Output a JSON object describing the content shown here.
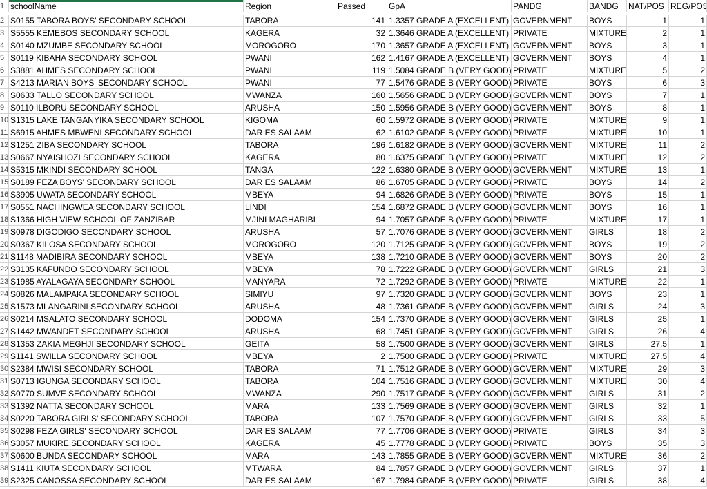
{
  "headers": [
    "schoolName",
    "Region",
    "Passed",
    "GpA",
    "PANDG",
    "BANDG",
    "NAT/POS",
    "REG/POS"
  ],
  "rows": [
    [
      "S0155 TABORA BOYS' SECONDARY SCHOOL",
      "TABORA",
      "141",
      "1.3357  GRADE A (EXCELLENT)",
      "GOVERNMENT",
      "BOYS",
      "1",
      "1"
    ],
    [
      "S5555 KEMEBOS SECONDARY SCHOOL",
      "KAGERA",
      "32",
      "1.3646  GRADE A (EXCELLENT)",
      "PRIVATE",
      "MIXTURE",
      "2",
      "1"
    ],
    [
      "S0140 MZUMBE SECONDARY SCHOOL",
      "MOROGORO",
      "170",
      "1.3657  GRADE A (EXCELLENT)",
      "GOVERNMENT",
      "BOYS",
      "3",
      "1"
    ],
    [
      "S0119 KIBAHA SECONDARY SCHOOL",
      "PWANI",
      "162",
      "1.4167  GRADE A (EXCELLENT)",
      "GOVERNMENT",
      "BOYS",
      "4",
      "1"
    ],
    [
      "S3881 AHMES SECONDARY SCHOOL",
      "PWANI",
      "119",
      "1.5084  GRADE B (VERY GOOD)",
      "PRIVATE",
      "MIXTURE",
      "5",
      "2"
    ],
    [
      "S4213 MARIAN BOYS'  SECONDARY SCHOOL",
      "PWANI",
      "77",
      "1.5476  GRADE B (VERY GOOD)",
      "PRIVATE",
      "BOYS",
      "6",
      "3"
    ],
    [
      "S0633 TALLO SECONDARY SCHOOL",
      "MWANZA",
      "160",
      "1.5656  GRADE B (VERY GOOD)",
      "GOVERNMENT",
      "BOYS",
      "7",
      "1"
    ],
    [
      "S0110 ILBORU SECONDARY SCHOOL",
      "ARUSHA",
      "150",
      "1.5956  GRADE B (VERY GOOD)",
      "GOVERNMENT",
      "BOYS",
      "8",
      "1"
    ],
    [
      "S1315 LAKE TANGANYIKA SECONDARY SCHOOL",
      "KIGOMA",
      "60",
      "1.5972  GRADE B (VERY GOOD)",
      "PRIVATE",
      "MIXTURE",
      "9",
      "1"
    ],
    [
      "S6915 AHMES MBWENI SECONDARY SCHOOL",
      "DAR ES SALAAM",
      "62",
      "1.6102  GRADE B (VERY GOOD)",
      "PRIVATE",
      "MIXTURE",
      "10",
      "1"
    ],
    [
      "S1251 ZIBA SECONDARY SCHOOL",
      "TABORA",
      "196",
      "1.6182  GRADE B (VERY GOOD)",
      "GOVERNMENT",
      "MIXTURE",
      "11",
      "2"
    ],
    [
      "S0667 NYAISHOZI SECONDARY SCHOOL",
      "KAGERA",
      "80",
      "1.6375  GRADE B (VERY GOOD)",
      "PRIVATE",
      "MIXTURE",
      "12",
      "2"
    ],
    [
      "S5315 MKINDI SECONDARY SCHOOL",
      "TANGA",
      "122",
      "1.6380  GRADE B (VERY GOOD)",
      "GOVERNMENT",
      "MIXTURE",
      "13",
      "1"
    ],
    [
      "S0189 FEZA BOYS' SECONDARY SCHOOL",
      "DAR ES SALAAM",
      "86",
      "1.6705  GRADE B (VERY GOOD)",
      "PRIVATE",
      "BOYS",
      "14",
      "2"
    ],
    [
      "S3905 UWATA SECONDARY SCHOOL",
      "MBEYA",
      "94",
      "1.6826  GRADE B (VERY GOOD)",
      "PRIVATE",
      "BOYS",
      "15",
      "1"
    ],
    [
      "S0551 NACHINGWEA SECONDARY SCHOOL",
      "LINDI",
      "154",
      "1.6872  GRADE B (VERY GOOD)",
      "GOVERNMENT",
      "BOYS",
      "16",
      "1"
    ],
    [
      "S1366 HIGH VIEW SCHOOL OF ZANZIBAR",
      "MJINI MAGHARIBI",
      "94",
      "1.7057  GRADE B (VERY GOOD)",
      "PRIVATE",
      "MIXTURE",
      "17",
      "1"
    ],
    [
      "S0978 DIGODIGO SECONDARY SCHOOL",
      "ARUSHA",
      "57",
      "1.7076  GRADE B (VERY GOOD)",
      "GOVERNMENT",
      "GIRLS",
      "18",
      "2"
    ],
    [
      "S0367 KILOSA SECONDARY SCHOOL",
      "MOROGORO",
      "120",
      "1.7125  GRADE B (VERY GOOD)",
      "GOVERNMENT",
      "BOYS",
      "19",
      "2"
    ],
    [
      "S1148 MADIBIRA SECONDARY SCHOOL",
      "MBEYA",
      "138",
      "1.7210  GRADE B (VERY GOOD)",
      "GOVERNMENT",
      "BOYS",
      "20",
      "2"
    ],
    [
      "S3135 KAFUNDO SECONDARY SCHOOL",
      "MBEYA",
      "78",
      "1.7222  GRADE B (VERY GOOD)",
      "GOVERNMENT",
      "GIRLS",
      "21",
      "3"
    ],
    [
      "S1985 AYALAGAYA SECONDARY SCHOOL",
      "MANYARA",
      "72",
      "1.7292  GRADE B (VERY GOOD)",
      "PRIVATE",
      "MIXTURE",
      "22",
      "1"
    ],
    [
      "S0826 MALAMPAKA SECONDARY SCHOOL",
      "SIMIYU",
      "97",
      "1.7320  GRADE B (VERY GOOD)",
      "GOVERNMENT",
      "BOYS",
      "23",
      "1"
    ],
    [
      "S1573 MLANGARINI SECONDARY SCHOOL",
      "ARUSHA",
      "48",
      "1.7361  GRADE B (VERY GOOD)",
      "GOVERNMENT",
      "GIRLS",
      "24",
      "3"
    ],
    [
      "S0214 MSALATO SECONDARY SCHOOL",
      "DODOMA",
      "154",
      "1.7370  GRADE B (VERY GOOD)",
      "GOVERNMENT",
      "GIRLS",
      "25",
      "1"
    ],
    [
      "S1442 MWANDET SECONDARY SCHOOL",
      "ARUSHA",
      "68",
      "1.7451  GRADE B (VERY GOOD)",
      "GOVERNMENT",
      "GIRLS",
      "26",
      "4"
    ],
    [
      "S1353 ZAKIA MEGHJI SECONDARY SCHOOL",
      "GEITA",
      "58",
      "1.7500  GRADE B (VERY GOOD)",
      "GOVERNMENT",
      "GIRLS",
      "27.5",
      "1"
    ],
    [
      "S1141 SWILLA SECONDARY SCHOOL",
      "MBEYA",
      "2",
      "1.7500  GRADE B (VERY GOOD)",
      "PRIVATE",
      "MIXTURE",
      "27.5",
      "4"
    ],
    [
      "S2384 MWISI SECONDARY SCHOOL",
      "TABORA",
      "71",
      "1.7512  GRADE B (VERY GOOD)",
      "GOVERNMENT",
      "MIXTURE",
      "29",
      "3"
    ],
    [
      "S0713 IGUNGA SECONDARY SCHOOL",
      "TABORA",
      "104",
      "1.7516  GRADE B (VERY GOOD)",
      "GOVERNMENT",
      "MIXTURE",
      "30",
      "4"
    ],
    [
      "S0770 SUMVE SECONDARY SCHOOL",
      "MWANZA",
      "290",
      "1.7517  GRADE B (VERY GOOD)",
      "GOVERNMENT",
      "GIRLS",
      "31",
      "2"
    ],
    [
      "S1392 NATTA SECONDARY SCHOOL",
      "MARA",
      "133",
      "1.7569  GRADE B (VERY GOOD)",
      "GOVERNMENT",
      "GIRLS",
      "32",
      "1"
    ],
    [
      "S0220 TABORA GIRLS' SECONDARY SCHOOL",
      "TABORA",
      "107",
      "1.7570  GRADE B (VERY GOOD)",
      "GOVERNMENT",
      "GIRLS",
      "33",
      "5"
    ],
    [
      "S0298 FEZA GIRLS' SECONDARY SCHOOL",
      "DAR ES SALAAM",
      "77",
      "1.7706  GRADE B (VERY GOOD)",
      "PRIVATE",
      "GIRLS",
      "34",
      "3"
    ],
    [
      "S3057 MUKIRE SECONDARY SCHOOL",
      "KAGERA",
      "45",
      "1.7778  GRADE B (VERY GOOD)",
      "PRIVATE",
      "BOYS",
      "35",
      "3"
    ],
    [
      "S0600 BUNDA SECONDARY SCHOOL",
      "MARA",
      "143",
      "1.7855  GRADE B (VERY GOOD)",
      "GOVERNMENT",
      "MIXTURE",
      "36",
      "2"
    ],
    [
      "S1411 KIUTA SECONDARY SCHOOL",
      "MTWARA",
      "84",
      "1.7857  GRADE B (VERY GOOD)",
      "GOVERNMENT",
      "GIRLS",
      "37",
      "1"
    ],
    [
      "S2325 CANOSSA SECONDARY SCHOOL",
      "DAR ES SALAAM",
      "167",
      "1.7984  GRADE B (VERY GOOD)",
      "PRIVATE",
      "GIRLS",
      "38",
      "4"
    ]
  ],
  "row_numbers": [
    "1",
    "2",
    "3",
    "4",
    "5",
    "6",
    "7",
    "8",
    "9",
    "10",
    "11",
    "12",
    "13",
    "14",
    "15",
    "16",
    "17",
    "18",
    "19",
    "20",
    "21",
    "22",
    "23",
    "24",
    "25",
    "26",
    "27",
    "28",
    "29",
    "30",
    "31",
    "32",
    "33",
    "34",
    "35",
    "36",
    "37",
    "38",
    "39"
  ],
  "colors": {
    "selection": "#217346",
    "gridline": "#d4d4d4"
  }
}
